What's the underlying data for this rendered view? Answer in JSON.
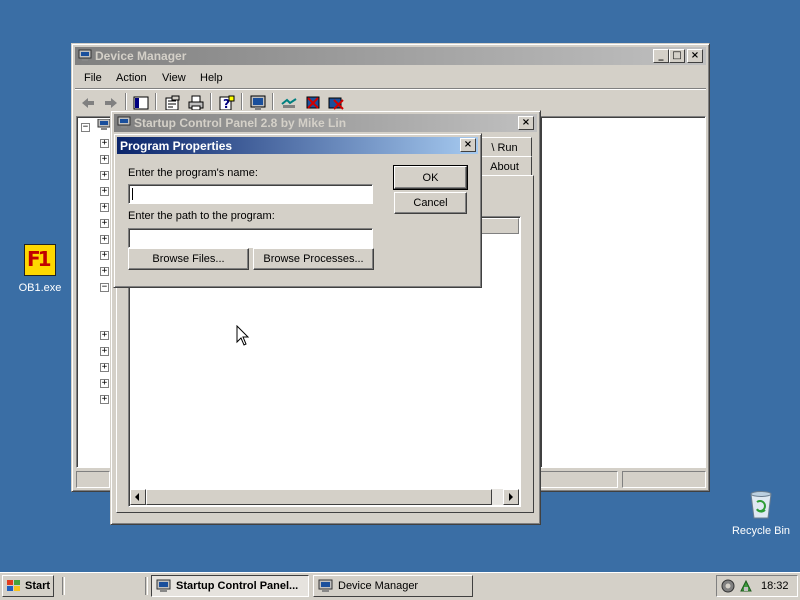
{
  "desktop": {
    "icons": [
      {
        "label": "OB1.exe",
        "glyph": "F1"
      },
      {
        "label": "Recycle Bin"
      }
    ]
  },
  "device_manager": {
    "title": "Device Manager",
    "menu": [
      "File",
      "Action",
      "View",
      "Help"
    ],
    "controls": {
      "minimize": "_",
      "maximize": "□",
      "close": "×"
    }
  },
  "startup_panel": {
    "title": "Startup Control Panel 2.8 by Mike Lin",
    "tabs": [
      "\\ Run",
      "About"
    ],
    "close": "×"
  },
  "dialog": {
    "title": "Program Properties",
    "name_label": "Enter the program's name:",
    "name_value": "",
    "path_label": "Enter the path to the program:",
    "path_value": "",
    "browse_files": "Browse Files...",
    "browse_processes": "Browse Processes...",
    "ok": "OK",
    "cancel": "Cancel",
    "close": "×"
  },
  "taskbar": {
    "start": "Start",
    "tasks": [
      "Startup Control Panel...",
      "Device Manager"
    ],
    "clock": "18:32"
  },
  "colors": {
    "desktop": "#3a6ea5",
    "active_title": "#0a246a",
    "inactive_title": "#808080",
    "face": "#d4d0c8"
  }
}
